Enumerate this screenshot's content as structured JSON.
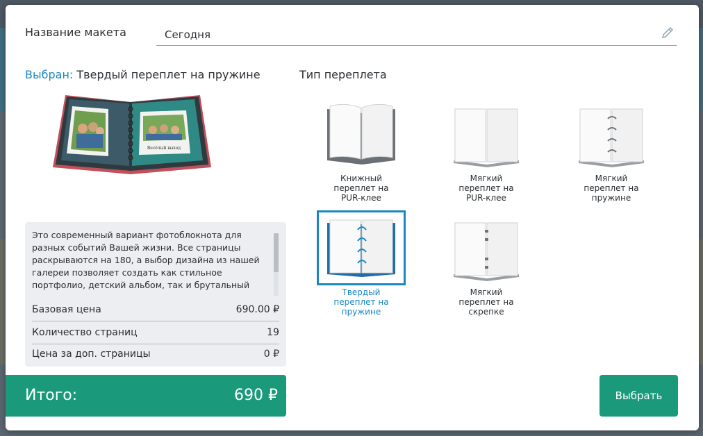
{
  "layout_name": {
    "label": "Название макета",
    "value": "Сегодня"
  },
  "selected": {
    "prefix": "Выбран:",
    "name": "Твердый переплет на пружине"
  },
  "preview": {
    "page_caption": "Весёлый выход"
  },
  "description": "Это современный вариант фотоблокнота для разных событий Вашей жизни. Все страницы раскрываются на 180, а выбор дизайна из нашей галереи позволяет создать как стильное портфолио, детский альбом, так и брутальный",
  "price_rows": [
    {
      "label": "Базовая цена",
      "value": "690.00 ₽"
    },
    {
      "label": "Количество страниц",
      "value": "19"
    },
    {
      "label": "Цена за доп. страницы",
      "value": "0 ₽"
    }
  ],
  "total": {
    "label": "Итого:",
    "value": "690 ₽"
  },
  "binding": {
    "title": "Тип переплета",
    "options": [
      {
        "label": "Книжный переплет на PUR-клее",
        "icon": "hardcover-book-icon",
        "selected": false
      },
      {
        "label": "Мягкий переплет на PUR-клее",
        "icon": "softcover-book-icon",
        "selected": false
      },
      {
        "label": "Мягкий переплет на пружине",
        "icon": "soft-spiral-book-icon",
        "selected": false
      },
      {
        "label": "Твердый переплет на пружине",
        "icon": "hard-spiral-book-icon",
        "selected": true
      },
      {
        "label": "Мягкий переплет на скрепке",
        "icon": "staple-book-icon",
        "selected": false
      }
    ]
  },
  "actions": {
    "choose_label": "Выбрать"
  },
  "colors": {
    "accent": "#1a87c4",
    "green": "#1a9a7a",
    "panel": "#eceef1"
  }
}
